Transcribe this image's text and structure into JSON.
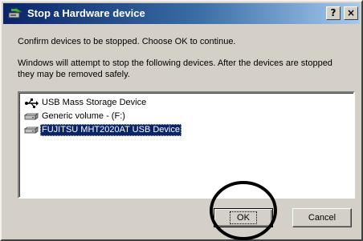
{
  "window": {
    "title": "Stop a Hardware device",
    "help_button": "?",
    "close_button": "×",
    "title_icon": "hardware-eject-icon"
  },
  "dialog": {
    "prompt": "Confirm devices to be stopped. Choose OK to continue.",
    "info": "Windows will attempt to stop the following devices. After the devices are stopped they may be removed safely."
  },
  "devices": [
    {
      "label": "USB Mass Storage Device",
      "icon": "usb-device-icon",
      "selected": false
    },
    {
      "label": "Generic volume - (F:)",
      "icon": "drive-icon",
      "selected": false
    },
    {
      "label": "FUJITSU MHT2020AT USB Device",
      "icon": "drive-icon",
      "selected": true
    }
  ],
  "buttons": {
    "ok": "OK",
    "cancel": "Cancel"
  },
  "colors": {
    "titlebar_start": "#0a246a",
    "titlebar_end": "#a6caf0",
    "face": "#d4d0c8",
    "selection": "#0a246a",
    "annotation": "#000000"
  }
}
